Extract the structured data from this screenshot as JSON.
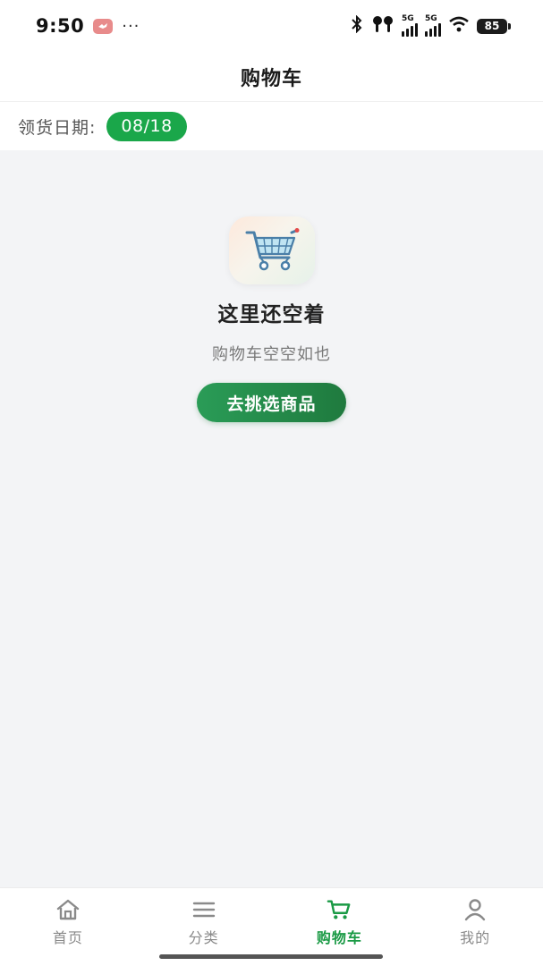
{
  "status_bar": {
    "time": "9:50",
    "more": "···",
    "signal_label_1": "5G",
    "signal_label_2": "5G",
    "battery": "85"
  },
  "nav": {
    "title": "购物车"
  },
  "date_row": {
    "label": "领货日期:",
    "date": "08/18"
  },
  "empty_state": {
    "icon": "shopping-cart-icon",
    "title": "这里还空着",
    "subtitle": "购物车空空如也",
    "button_label": "去挑选商品"
  },
  "tab_bar": {
    "active_color": "#1a9a45",
    "inactive_color": "#8a8a8a",
    "items": [
      {
        "label": "首页",
        "icon": "home-icon",
        "active": false
      },
      {
        "label": "分类",
        "icon": "menu-icon",
        "active": false
      },
      {
        "label": "购物车",
        "icon": "cart-icon",
        "active": true
      },
      {
        "label": "我的",
        "icon": "user-icon",
        "active": false
      }
    ]
  },
  "colors": {
    "brand_green": "#1aa74a",
    "background": "#f3f4f6"
  }
}
